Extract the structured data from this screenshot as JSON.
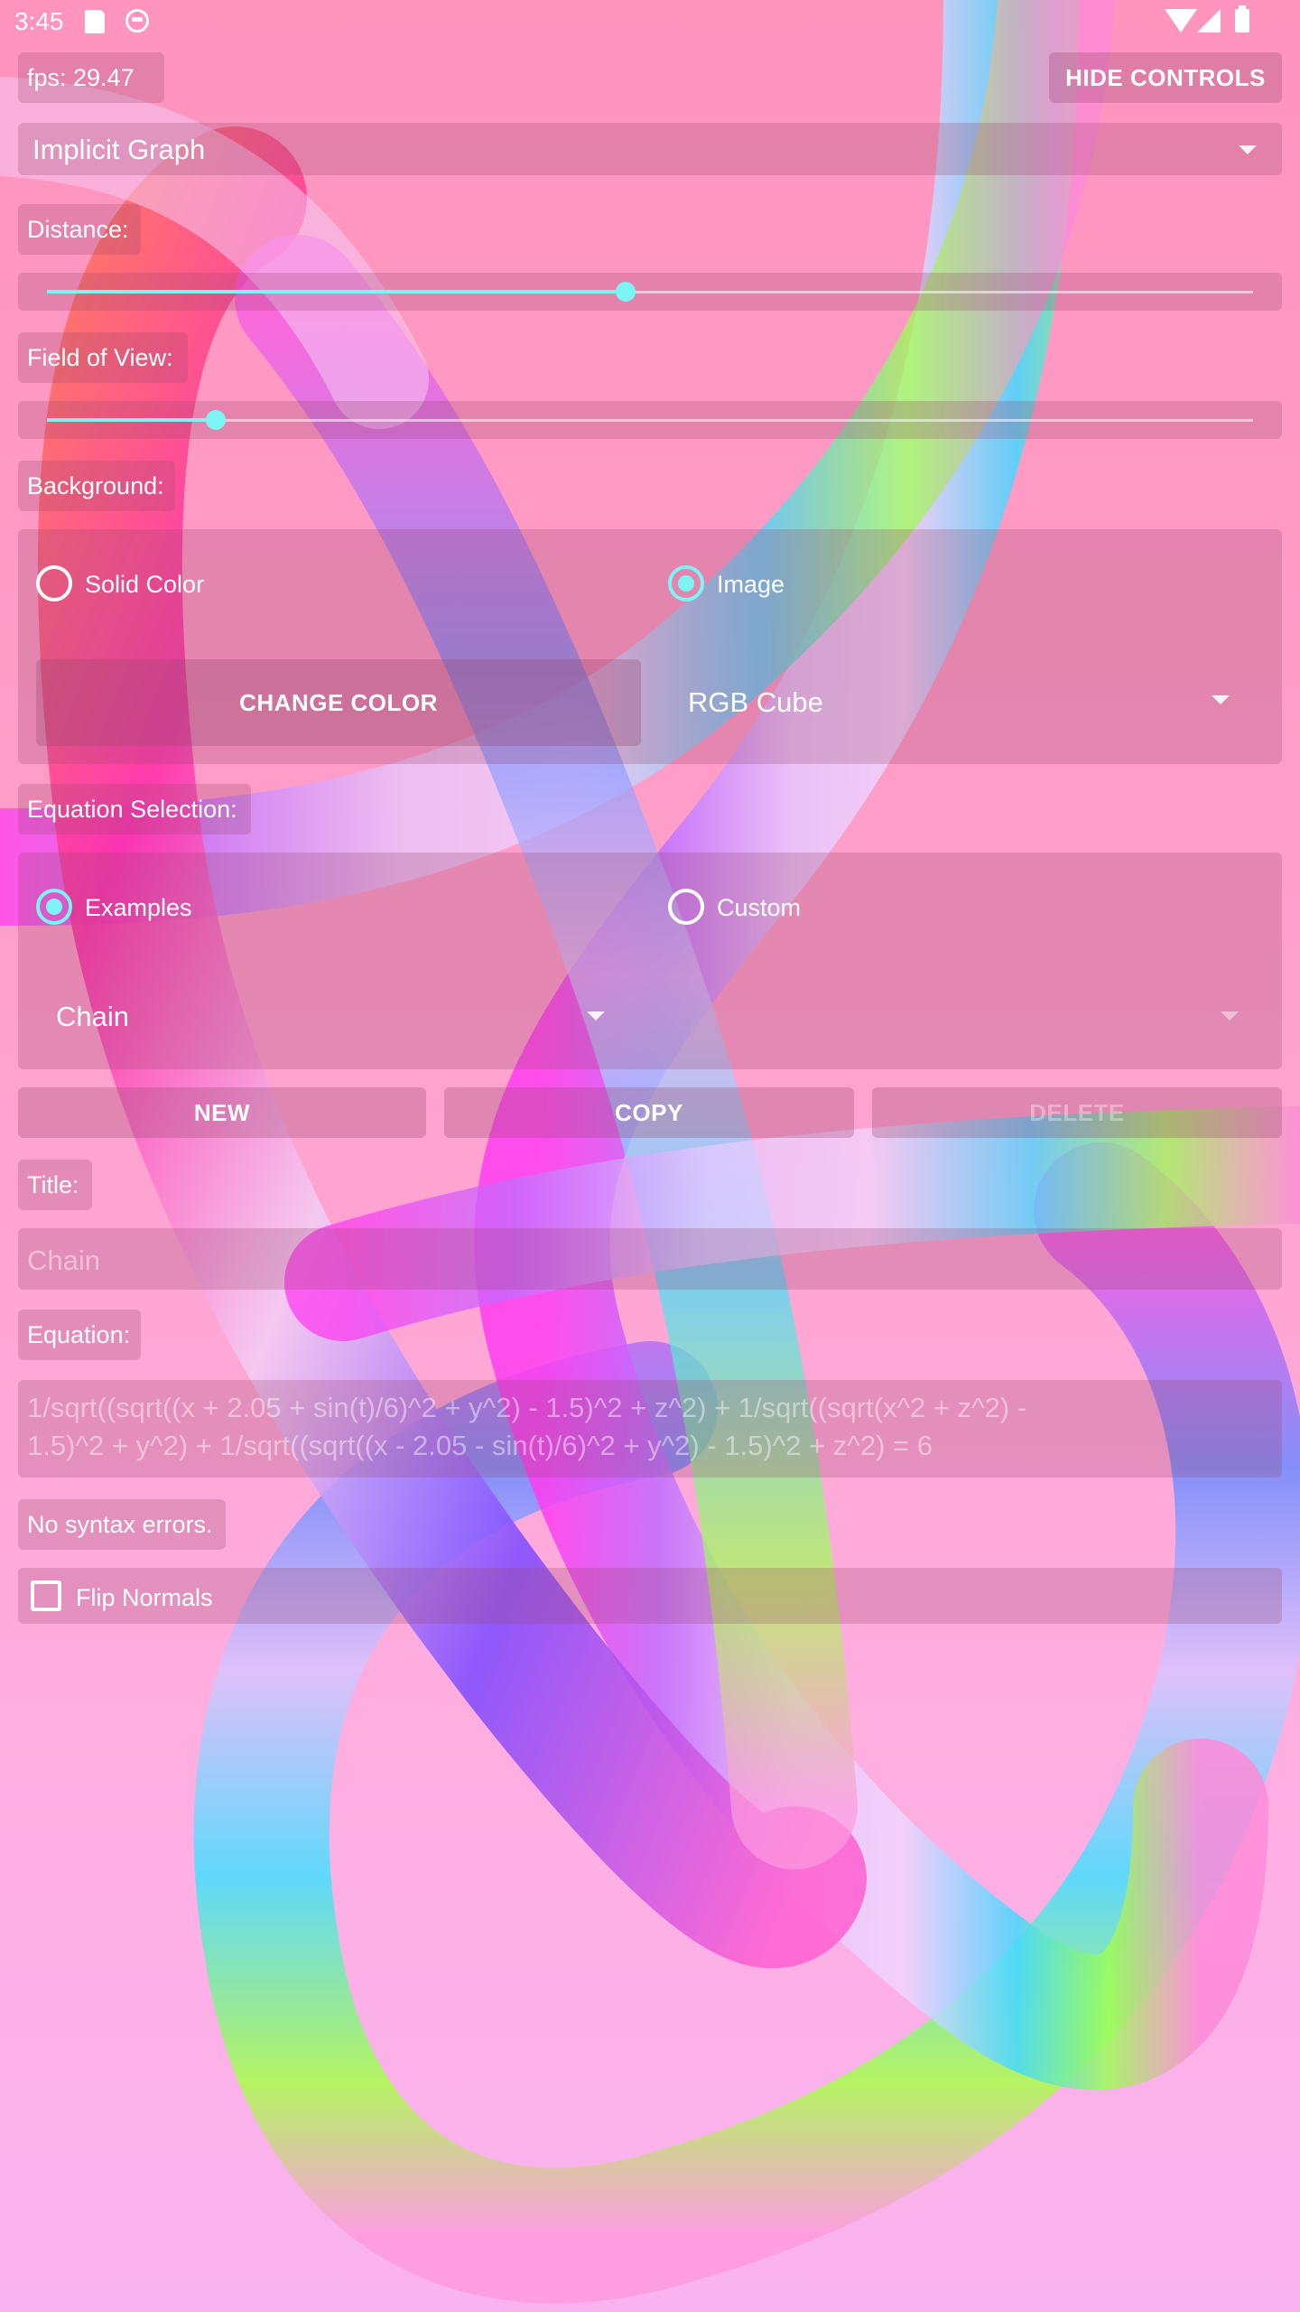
{
  "status_bar": {
    "time": "3:45"
  },
  "fps": {
    "label": "fps: 29.47"
  },
  "hide_controls": {
    "label": "HIDE CONTROLS"
  },
  "mode_select": {
    "value": "Implicit Graph"
  },
  "distance": {
    "label": "Distance:",
    "level": 0.48
  },
  "fov": {
    "label": "Field of View:",
    "level": 0.14
  },
  "background": {
    "label": "Background:",
    "options": [
      "Solid Color",
      "Image"
    ],
    "selected": "Image",
    "change_color_label": "CHANGE COLOR",
    "image_value": "RGB Cube"
  },
  "equation_selection": {
    "label": "Equation Selection:",
    "options": [
      "Examples",
      "Custom"
    ],
    "selected": "Examples",
    "example_value": "Chain"
  },
  "actions": {
    "new": "NEW",
    "copy": "COPY",
    "delete": "DELETE"
  },
  "title": {
    "label": "Title:",
    "value": "Chain"
  },
  "equation": {
    "label": "Equation:",
    "line1": "1/sqrt((sqrt((x + 2.05 + sin(t)/6)^2 + y^2) - 1.5)^2 + z^2) + 1/sqrt((sqrt(x^2 + z^2) -",
    "line2": "1.5)^2 + y^2) + 1/sqrt((sqrt((x - 2.05 - sin(t)/6)^2 + y^2) - 1.5)^2 + z^2) = 6"
  },
  "syntax_status": "No syntax errors.",
  "flip_normals": {
    "label": "Flip Normals",
    "checked": false
  },
  "colors": {
    "accent": "#7cf4f4",
    "panel": "#96466e"
  }
}
